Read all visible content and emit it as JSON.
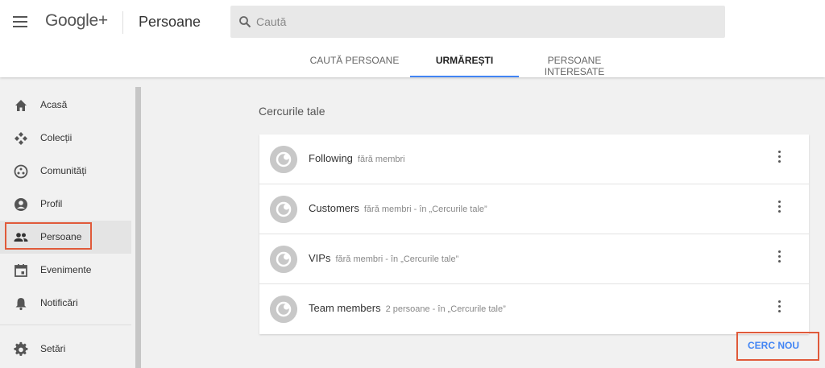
{
  "header": {
    "logo": "Google+",
    "page_title": "Persoane",
    "search_placeholder": "Caută"
  },
  "tabs": [
    {
      "label": "CAUTĂ PERSOANE",
      "active": false
    },
    {
      "label": "URMĂREȘTI",
      "active": true
    },
    {
      "label": "PERSOANE INTERESATE",
      "active": false
    }
  ],
  "sidebar": {
    "items": [
      {
        "label": "Acasă",
        "icon": "home-icon"
      },
      {
        "label": "Colecții",
        "icon": "collections-icon"
      },
      {
        "label": "Comunități",
        "icon": "communities-icon"
      },
      {
        "label": "Profil",
        "icon": "profile-icon"
      },
      {
        "label": "Persoane",
        "icon": "people-icon",
        "active": true
      },
      {
        "label": "Evenimente",
        "icon": "calendar-icon"
      },
      {
        "label": "Notificări",
        "icon": "bell-icon"
      },
      {
        "label": "Setări",
        "icon": "gear-icon"
      }
    ]
  },
  "main": {
    "section_title": "Cercurile tale",
    "circles": [
      {
        "name": "Following",
        "meta": "fără membri"
      },
      {
        "name": "Customers",
        "meta": "fără membri - în „Cercurile tale”"
      },
      {
        "name": "VIPs",
        "meta": "fără membri - în „Cercurile tale”"
      },
      {
        "name": "Team members",
        "meta": "2 persoane - în „Cercurile tale”"
      }
    ],
    "new_circle_label": "CERC NOU"
  },
  "colors": {
    "accent": "#4285f4",
    "highlight_box": "#e05a3a"
  }
}
